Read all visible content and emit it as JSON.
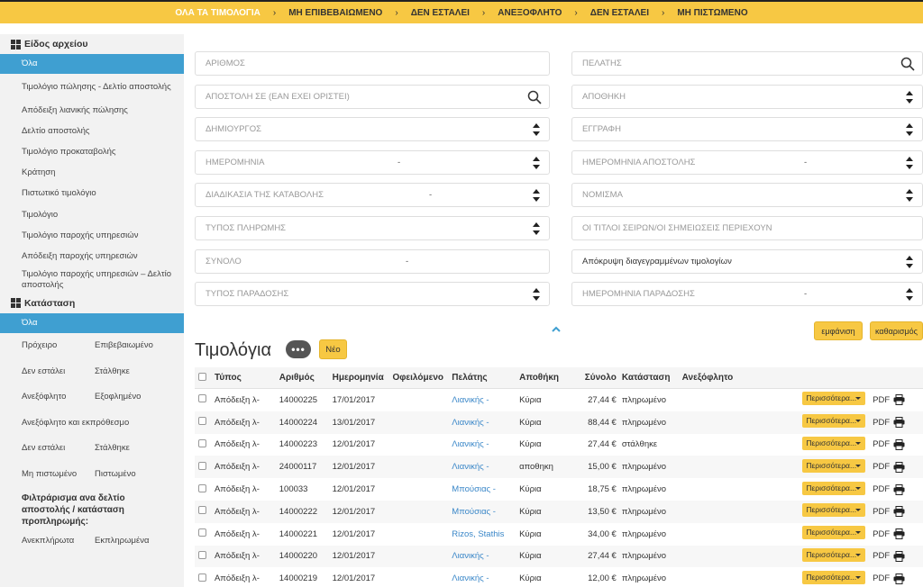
{
  "topbar": {
    "crumbs": [
      {
        "label": "ΟΛΑ ΤΑ ΤΙΜΟΛΟΓΙΑ",
        "active": true
      },
      {
        "label": "ΜΗ ΕΠΙΒΕΒΑΙΩΜΕΝΟ"
      },
      {
        "label": "ΔΕΝ ΕΣΤΑΛΕΙ"
      },
      {
        "label": "ΑΝΕΞΟΦΛΗΤΟ"
      },
      {
        "label": "ΔΕΝ ΕΣΤΑΛΕΙ"
      },
      {
        "label": "ΜΗ ΠΙΣΤΩΜΕΝΟ"
      }
    ],
    "separator": "›"
  },
  "sidebar": {
    "doc_type_heading": "Είδος αρχείου",
    "doc_types": [
      "Όλα",
      "Τιμολόγιο πώλησης - Δελτίο αποστολής",
      "Απόδειξη λιανικής πώλησης",
      "Δελτίο αποστολής",
      "Τιμολόγιο προκαταβολής",
      "Κράτηση",
      "Πιστωτικό τιμολόγιο",
      "Τιμολόγιο",
      "Τιμολόγιο παροχής υπηρεσιών",
      "Απόδειξη παροχής υπηρεσιών",
      "Τιμολόγιο παροχής υπηρεσιών – Δελτίο αποστολής"
    ],
    "status_heading": "Κατάσταση",
    "status_all": "Όλα",
    "status_pairs": [
      [
        "Πρόχειρο",
        "Επιβεβαιωμένο"
      ],
      [
        "Δεν εστάλει",
        "Στάλθηκε"
      ],
      [
        "Ανεξόφλητο",
        "Εξοφλημένο"
      ]
    ],
    "status_single": "Ανεξόφλητο και εκπρόθεσμο",
    "status_pairs2": [
      [
        "Δεν εστάλει",
        "Στάλθηκε"
      ],
      [
        "Μη πιστωμένο",
        "Πιστωμένο"
      ]
    ],
    "filter_title": "Φιλτράρισμα ανα δελτίο αποστολής / κατάσταση προπληρωμής:",
    "filter_pair": [
      "Ανεκπλήρωτα",
      "Εκπληρωμένα"
    ]
  },
  "filters": {
    "number": "ΑΡΙΘΜΟΣ",
    "customer": "ΠΕΛΑΤΗΣ",
    "shipping": "ΑΠΟΣΤΟΛΗ ΣΕ (ΕΑΝ ΕΧΕΙ ΟΡΙΣΤΕΙ)",
    "warehouse": "ΑΠΟΘΗΚΗ",
    "creator": "ΔΗΜΙΟΥΡΓΟΣ",
    "entry": "ΕΓΓΡΑΦΗ",
    "date": "ΗΜΕΡΟΜΗΝΙΑ",
    "ship_date": "ΗΜΕΡΟΜΗΝΙΑ ΑΠΟΣΤΟΛΗΣ",
    "payment_process": "ΔΙΑΔΙΚΑΣΙΑ ΤΗΣ ΚΑΤΑΒΟΛΗΣ",
    "currency": "ΝΟΜΙΣΜΑ",
    "payment_type": "ΤΥΠΟΣ ΠΛΗΡΩΜΗΣ",
    "titles_contain": "ΟΙ ΤΙΤΛΟΙ ΣΕΙΡΩΝ/ΟΙ ΣΗΜΕΙΩΣΕΙΣ ΠΕΡΙΕΧΟΥΝ",
    "total": "ΣΥΝΟΛΟ",
    "hide_deleted": "Απόκρυψη διαγεγραμμένων τιμολογίων",
    "delivery_type": "ΤΥΠΟΣ ΠΑΡΑΔΟΣΗΣ",
    "delivery_date": "ΗΜΕΡΟΜΗΝΙΑ ΠΑΡΑΔΟΣΗΣ",
    "range_dash": "-",
    "show_button": "εμφάνιση",
    "clear_button": "καθαρισμός"
  },
  "main": {
    "title": "Τιμολόγια",
    "more_badge": "•••",
    "new_button": "Νέο"
  },
  "table": {
    "headers": {
      "type": "Τύπος",
      "number": "Αριθμός",
      "date": "Ημερομηνία",
      "owed": "Οφειλόμενο",
      "customer": "Πελάτης",
      "warehouse": "Αποθήκη",
      "total": "Σύνολο",
      "status": "Κατάσταση",
      "unpaid": "Ανεξόφλητο"
    },
    "more_label": "Περισσότερα...",
    "pdf_label": "PDF",
    "rows": [
      {
        "type": "Απόδειξη λ-",
        "number": "14000225",
        "date": "17/01/2017",
        "customer": "Λιανικής -",
        "warehouse": "Κύρια",
        "total": "27,44 €",
        "status": "πληρωμένο"
      },
      {
        "type": "Απόδειξη λ-",
        "number": "14000224",
        "date": "13/01/2017",
        "customer": "Λιανικής -",
        "warehouse": "Κύρια",
        "total": "88,44 €",
        "status": "πληρωμένο"
      },
      {
        "type": "Απόδειξη λ-",
        "number": "14000223",
        "date": "12/01/2017",
        "customer": "Λιανικής -",
        "warehouse": "Κύρια",
        "total": "27,44 €",
        "status": "στάλθηκε"
      },
      {
        "type": "Απόδειξη λ-",
        "number": "24000117",
        "date": "12/01/2017",
        "customer": "Λιανικής -",
        "warehouse": "αποθηκη",
        "total": "15,00 €",
        "status": "πληρωμένο"
      },
      {
        "type": "Απόδειξη λ-",
        "number": "100033",
        "date": "12/01/2017",
        "customer": "Μπούσιας -",
        "warehouse": "Κύρια",
        "total": "18,75 €",
        "status": "πληρωμένο"
      },
      {
        "type": "Απόδειξη λ-",
        "number": "14000222",
        "date": "12/01/2017",
        "customer": "Μπούσιας -",
        "warehouse": "Κύρια",
        "total": "13,50 €",
        "status": "πληρωμένο"
      },
      {
        "type": "Απόδειξη λ-",
        "number": "14000221",
        "date": "12/01/2017",
        "customer": "Rizos, Stathis",
        "warehouse": "Κύρια",
        "total": "34,00 €",
        "status": "πληρωμένο"
      },
      {
        "type": "Απόδειξη λ-",
        "number": "14000220",
        "date": "12/01/2017",
        "customer": "Λιανικής -",
        "warehouse": "Κύρια",
        "total": "27,44 €",
        "status": "πληρωμένο"
      },
      {
        "type": "Απόδειξη λ-",
        "number": "14000219",
        "date": "12/01/2017",
        "customer": "Λιανικής -",
        "warehouse": "Κύρια",
        "total": "12,00 €",
        "status": "πληρωμένο"
      }
    ]
  },
  "colors": {
    "accent_yellow": "#f7c843",
    "selected_blue": "#3f9fd1",
    "link_blue": "#3a87c8"
  }
}
